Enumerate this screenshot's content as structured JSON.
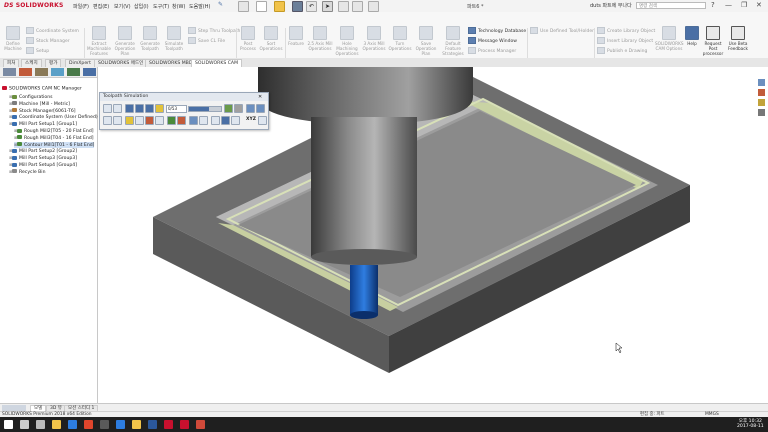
{
  "app": {
    "logo_text": "SOLIDWORKS",
    "logo_mark": "DS",
    "menu": [
      "파일(F)",
      "편집(E)",
      "보기(V)",
      "삽입(I)",
      "도구(T)",
      "창(W)",
      "도움말(H)"
    ],
    "doc_title": "파트6 *",
    "user": "duts 파트에 부나다",
    "search_placeholder": "명령 검색",
    "win_controls": [
      "?",
      "—",
      "❐",
      "✕"
    ]
  },
  "ribbon": {
    "groups": [
      {
        "label": "Define Machine",
        "enabled": false
      },
      {
        "label": "Extract Machinable Features",
        "enabled": false
      },
      {
        "label": "Generate Operation Plan",
        "enabled": false
      },
      {
        "label": "Generate Toolpath",
        "enabled": false
      },
      {
        "label": "Simulate Toolpath",
        "enabled": false
      },
      {
        "label": "Post Process",
        "enabled": false
      },
      {
        "label": "Sort Operations",
        "enabled": false
      },
      {
        "label": "Feature",
        "enabled": false
      },
      {
        "label": "2.5 Axis Mill Operations",
        "enabled": false
      },
      {
        "label": "Hole Machining Operations",
        "enabled": false
      },
      {
        "label": "3 Axis Mill Operations",
        "enabled": false
      },
      {
        "label": "Turn Operations",
        "enabled": false
      },
      {
        "label": "Save Operation Plan",
        "enabled": false
      },
      {
        "label": "Default Feature Strategies",
        "enabled": false
      },
      {
        "label": "SOLIDWORKS CAM Options",
        "enabled": false
      },
      {
        "label": "Help",
        "enabled": true
      },
      {
        "label": "Request Post processor",
        "enabled": true
      },
      {
        "label": "Use Beta Feedback",
        "enabled": true
      }
    ],
    "small_items": [
      {
        "label": "Coordinate System",
        "enabled": false
      },
      {
        "label": "Stock Manager",
        "enabled": false
      },
      {
        "label": "Setup",
        "enabled": false
      },
      {
        "label": "Step Thru Toolpath",
        "enabled": false
      },
      {
        "label": "Save CL File",
        "enabled": false
      },
      {
        "label": "Technology Database",
        "enabled": true
      },
      {
        "label": "Message Window",
        "enabled": true
      },
      {
        "label": "Process Manager",
        "enabled": false
      },
      {
        "label": "Use Defined Tool/Holder",
        "enabled": false
      },
      {
        "label": "Create Library Object",
        "enabled": false
      },
      {
        "label": "Insert Library Object",
        "enabled": false
      },
      {
        "label": "Publish e Drawing",
        "enabled": false
      }
    ]
  },
  "tabs": [
    "피처",
    "스케치",
    "평가",
    "DimXpert",
    "SOLIDWORKS 애드인",
    "SOLIDWORKS MBD",
    "SOLIDWORKS CAM"
  ],
  "active_tab_index": 6,
  "tree": {
    "root": "SOLIDWORKS CAM NC Manager",
    "items": [
      {
        "label": "Configurations",
        "level": 1,
        "color": "#6b8e3e",
        "selected": false
      },
      {
        "label": "Machine [Mill - Metric]",
        "level": 1,
        "color": "#7d7d7d",
        "selected": false
      },
      {
        "label": "Stock Manager[6061-T6]",
        "level": 1,
        "color": "#b07a3a",
        "selected": false
      },
      {
        "label": "Coordinate System (User Defined)",
        "level": 1,
        "color": "#3a6fb0",
        "selected": false
      },
      {
        "label": "Mill Part Setup1 [Group1]",
        "level": 1,
        "color": "#3a6fb0",
        "selected": false
      },
      {
        "label": "Rough Mill2[T05 - 20 Flat End]",
        "level": 2,
        "color": "#4a8a3a",
        "selected": false
      },
      {
        "label": "Rough Mill3[T04 - 16 Flat End]",
        "level": 2,
        "color": "#4a8a3a",
        "selected": false
      },
      {
        "label": "Contour Mill1[T01 - 6 Flat End]",
        "level": 2,
        "color": "#4a8a3a",
        "selected": true
      },
      {
        "label": "Mill Part Setup2 [Group2]",
        "level": 1,
        "color": "#3a6fb0",
        "selected": false
      },
      {
        "label": "Mill Part Setup3 [Group3]",
        "level": 1,
        "color": "#3a6fb0",
        "selected": false
      },
      {
        "label": "Mill Part Setup4 [Group4]",
        "level": 1,
        "color": "#3a6fb0",
        "selected": false
      },
      {
        "label": "Recycle Bin",
        "level": 1,
        "color": "#8a8a8a",
        "selected": false
      }
    ]
  },
  "sim_dialog": {
    "title": "Toolpath Simulation",
    "close": "✕",
    "speed_label": "0/53",
    "progress": 0.62,
    "xyz_label": "XYZ"
  },
  "bottom_tabs": [
    "모델",
    "3D 뷰",
    "모션 스터디 1"
  ],
  "active_bottom_tab": 0,
  "status": {
    "left": "SOLIDWORKS Premium 2018 x64 Edition",
    "mode": "편집 중: 파트",
    "units": "MMGS"
  },
  "taskbar": {
    "time": "오후 10:32",
    "date": "2017-08-11",
    "icons": [
      "start",
      "search",
      "task-view",
      "explorer",
      "edge",
      "chrome",
      "store",
      "mail",
      "folder",
      "word",
      "solidworks-icon-1",
      "solidworks-icon-2",
      "app-icon"
    ]
  }
}
